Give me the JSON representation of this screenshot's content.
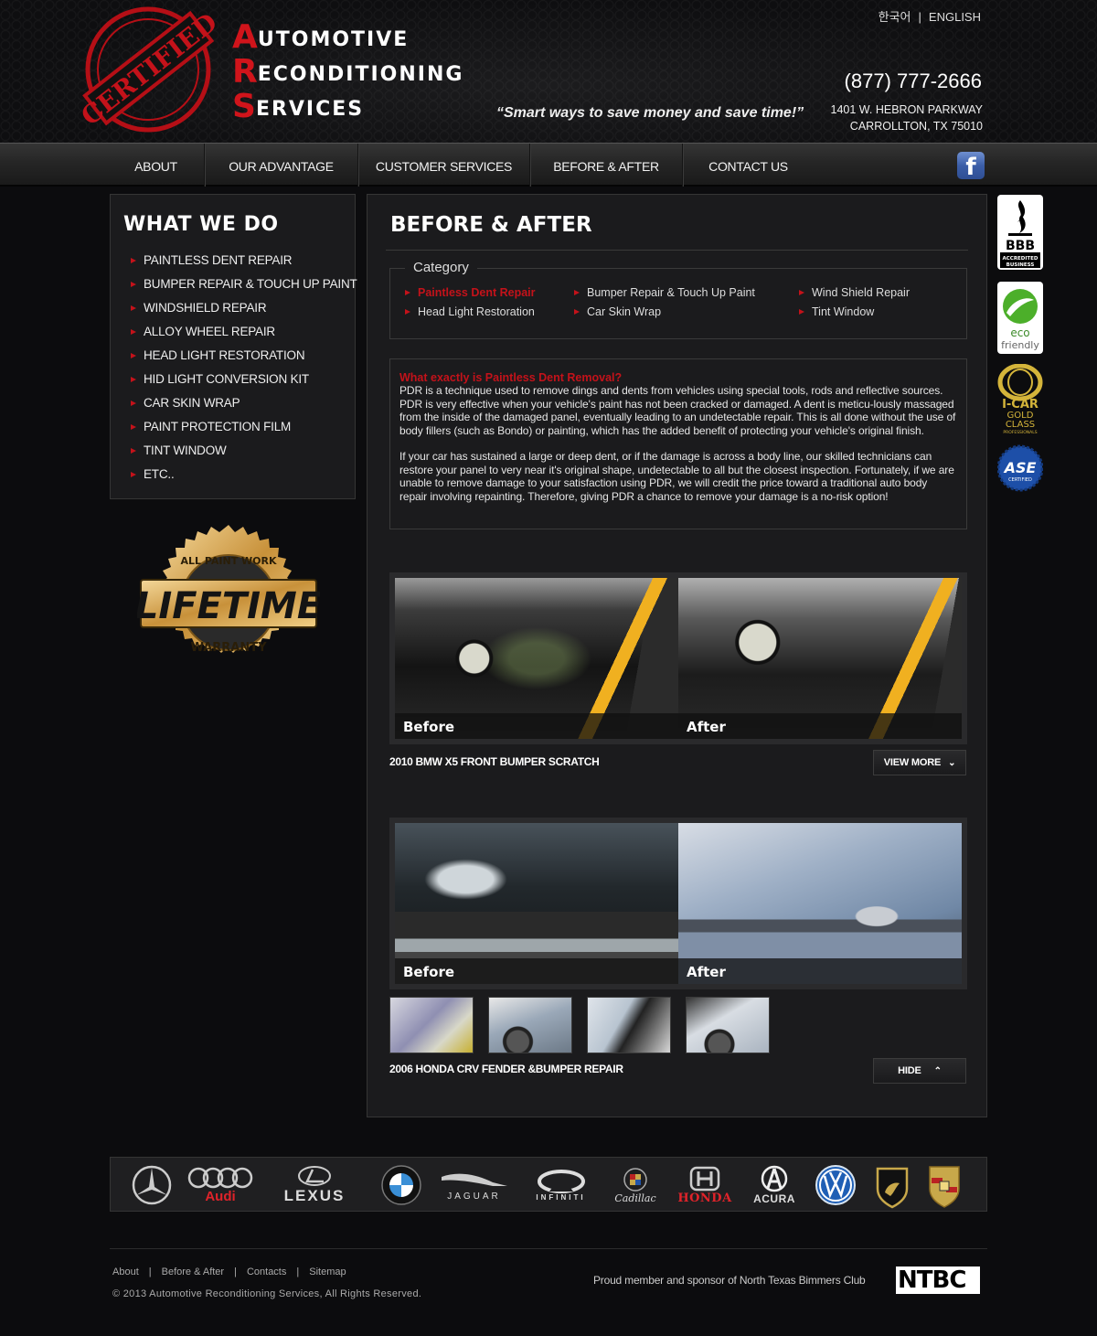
{
  "header": {
    "logo": {
      "stamp_text": "CERTIFIED",
      "lines": [
        {
          "initial": "A",
          "rest": "UTOMOTIVE"
        },
        {
          "initial": "R",
          "rest": "ECONDITIONING"
        },
        {
          "initial": "S",
          "rest": "ERVICES"
        }
      ]
    },
    "tagline": "“Smart ways to save money and save time!”",
    "languages": [
      "한국어",
      "ENGLISH"
    ],
    "lang_separator": "|",
    "phone": "(877) 777-2666",
    "address_line1": "1401 W. HEBRON PARKWAY",
    "address_line2": "CARROLLTON, TX 75010"
  },
  "nav": {
    "items": [
      {
        "label": "ABOUT"
      },
      {
        "label": "OUR ADVANTAGE"
      },
      {
        "label": "CUSTOMER SERVICES"
      },
      {
        "label": "BEFORE & AFTER"
      },
      {
        "label": "CONTACT US"
      }
    ],
    "facebook_glyph": "f"
  },
  "sidebar": {
    "title": "WHAT WE DO",
    "items": [
      {
        "label": "PAINTLESS DENT REPAIR"
      },
      {
        "label": "BUMPER REPAIR & TOUCH UP PAINT"
      },
      {
        "label": "WINDSHIELD REPAIR"
      },
      {
        "label": "ALLOY WHEEL REPAIR"
      },
      {
        "label": "HEAD LIGHT RESTORATION"
      },
      {
        "label": "HID LIGHT CONVERSION KIT"
      },
      {
        "label": "CAR SKIN WRAP"
      },
      {
        "label": "PAINT PROTECTION FILM"
      },
      {
        "label": "TINT WINDOW"
      },
      {
        "label": "ETC.."
      }
    ],
    "warranty": {
      "top": "ALL PAINT WORK",
      "middle": "LIFETIME",
      "bottom": "WARRANTY"
    }
  },
  "main": {
    "title": "BEFORE & AFTER",
    "category": {
      "legend": "Category",
      "items": [
        {
          "label": "Paintless Dent Repair",
          "active": true
        },
        {
          "label": "Bumper Repair & Touch Up Paint"
        },
        {
          "label": "Wind Shield Repair"
        },
        {
          "label": "Head Light Restoration"
        },
        {
          "label": "Car Skin Wrap"
        },
        {
          "label": "Tint Window"
        }
      ]
    },
    "info": {
      "question": "What exactly is Paintless Dent Removal?",
      "paragraph1": "PDR is a technique used to remove dings and dents from vehicles using special tools, rods and reflective sources. PDR is very effective when your vehicle's paint has not been cracked or damaged. A dent is meticu-lously massaged from the inside of the damaged panel, eventually leading to an undetectable repair. This is all done without the use of body fillers (such as Bondo) or painting, which has the added benefit of protecting your vehicle's original finish.",
      "paragraph2": "If your car has sustained a large or deep dent, or if the damage is across a body line, our skilled technicians can restore your panel to very near it's original shape, undetectable to all but the closest inspection. Fortunately, if we are unable to remove damage to your satisfaction using PDR, we will credit the price toward a traditional auto body repair involving repainting. Therefore, giving PDR a chance to remove your damage is a no-risk option!"
    },
    "galleries": [
      {
        "before_label": "Before",
        "after_label": "After",
        "caption": "2010 BMW X5 FRONT BUMPER SCRATCH",
        "button_label": "VIEW MORE",
        "button_icon": "chevron-down"
      },
      {
        "before_label": "Before",
        "after_label": "After",
        "caption": "2006 HONDA CRV FENDER &BUMPER REPAIR",
        "button_label": "HIDE",
        "button_icon": "chevron-up",
        "thumbnail_count": 4
      }
    ]
  },
  "badges": [
    {
      "name": "BBB",
      "line1": "ACCREDITED",
      "line2": "BUSINESS"
    },
    {
      "name": "eco friendly",
      "line1": "eco",
      "line2": "friendly"
    },
    {
      "name": "I-CAR",
      "line1": "GOLD",
      "line2": "CLASS",
      "line3": "PROFESSIONALS"
    },
    {
      "name": "ASE",
      "line1": "CERTIFIED"
    }
  ],
  "brands": [
    "Mercedes-Benz",
    "Audi",
    "LEXUS",
    "BMW",
    "JAGUAR",
    "INFINITI",
    "Cadillac",
    "HONDA",
    "ACURA",
    "Volkswagen",
    "Lamborghini",
    "Porsche"
  ],
  "footer": {
    "links": [
      "About",
      "Before & After",
      "Contacts",
      "Sitemap"
    ],
    "separator": "|",
    "copyright": "© 2013 Automotive Reconditioning Services, All Rights Reserved.",
    "sponsor": "Proud member and sponsor of North Texas Bimmers Club",
    "ntbc_logo": "NTBC"
  },
  "colors": {
    "accent_red": "#c4121a",
    "background": "#0c0c0e",
    "panel": "#1b1b1d",
    "facebook_blue": "#3b5ea8"
  }
}
